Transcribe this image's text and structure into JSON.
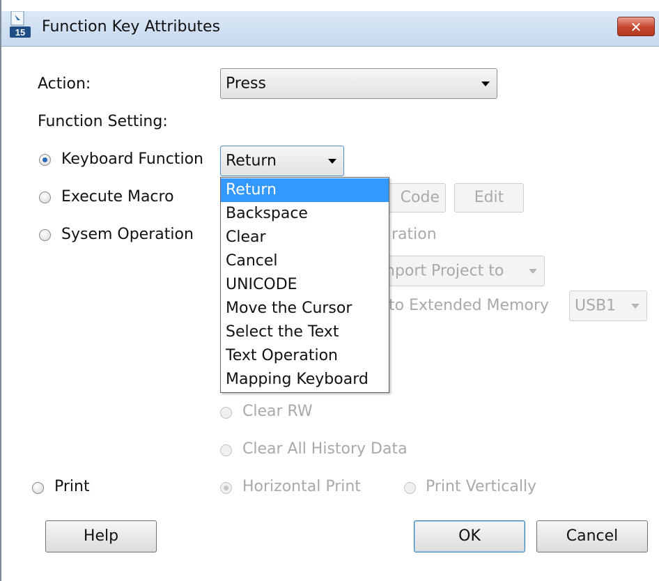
{
  "window": {
    "title": "Function Key Attributes",
    "app_icon_badge": "15",
    "close_label": "✕"
  },
  "action": {
    "label": "Action:",
    "value": "Press"
  },
  "function_setting": {
    "label": "Function Setting:"
  },
  "keyboard_function": {
    "label": "Keyboard Function",
    "selected": true,
    "combo_value": "Return",
    "options": [
      "Return",
      "Backspace",
      "Clear",
      "Cancel",
      "UNICODE",
      "Move the Cursor",
      "Select the Text",
      "Text Operation",
      "Mapping Keyboard"
    ],
    "highlighted_option": "Return"
  },
  "execute_macro": {
    "label": "Execute Macro",
    "selected": false,
    "code_button": "Code",
    "edit_button": "Edit"
  },
  "system_operation": {
    "label": "Sysem Operation",
    "selected": false,
    "partial_operation_text": "ration",
    "import_combo": "nport Project to",
    "extended_memory_label": "to Extended Memory",
    "usb_combo": "USB1",
    "clear_rw": "Clear RW",
    "clear_all_history": "Clear All History Data"
  },
  "print": {
    "label": "Print",
    "selected": false,
    "horizontal": "Horizontal Print",
    "horizontal_selected": true,
    "vertical": "Print Vertically",
    "vertical_selected": false
  },
  "buttons": {
    "help": "Help",
    "ok": "OK",
    "cancel": "Cancel"
  },
  "colors": {
    "highlight": "#3399ff",
    "disabled_text": "#a9a9a9",
    "close_button": "#c7442c"
  }
}
